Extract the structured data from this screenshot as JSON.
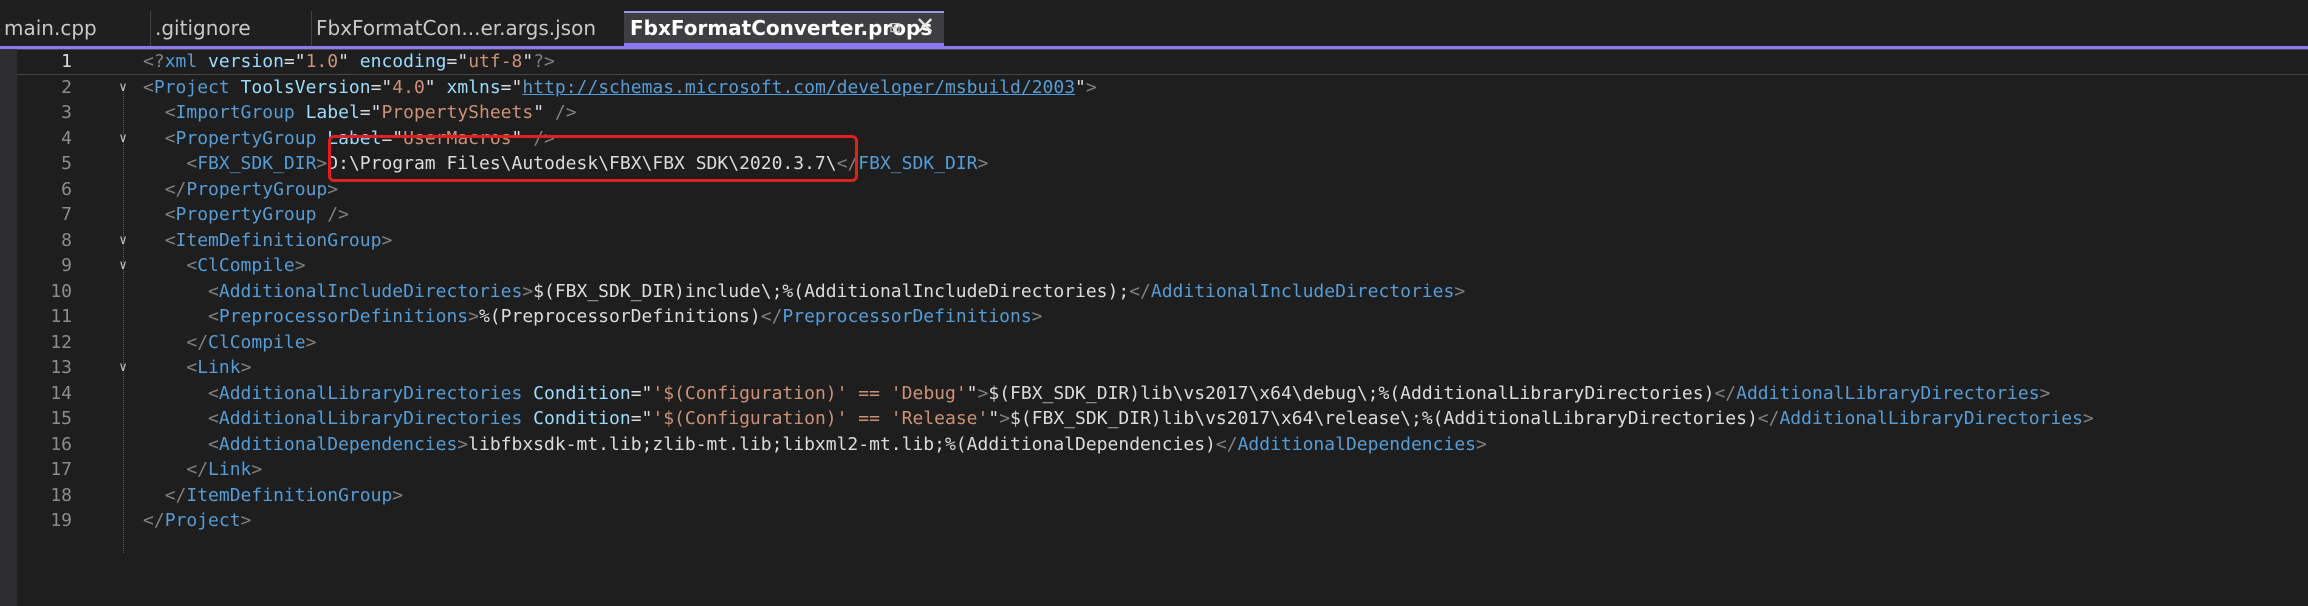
{
  "tabs": [
    {
      "label": "main.cpp",
      "active": false
    },
    {
      "label": ".gitignore",
      "active": false
    },
    {
      "label": "FbxFormatCon...er.args.json",
      "active": false
    },
    {
      "label": "FbxFormatConverter.props",
      "active": true
    }
  ],
  "tab_icons": {
    "pin": "pin-icon",
    "close": "close-icon"
  },
  "lines": [
    {
      "n": "1",
      "fold": "",
      "t": [
        [
          "b",
          "<?"
        ],
        [
          "t",
          "xml"
        ],
        [
          "x",
          " "
        ],
        [
          "a",
          "version"
        ],
        [
          "x",
          "=\""
        ],
        [
          "v",
          "1.0"
        ],
        [
          "x",
          "\" "
        ],
        [
          "a",
          "encoding"
        ],
        [
          "x",
          "=\""
        ],
        [
          "v",
          "utf-8"
        ],
        [
          "x",
          "\""
        ],
        [
          "b",
          "?>"
        ]
      ]
    },
    {
      "n": "2",
      "fold": "open",
      "t": [
        [
          "b",
          "<"
        ],
        [
          "t",
          "Project"
        ],
        [
          "x",
          " "
        ],
        [
          "a",
          "ToolsVersion"
        ],
        [
          "x",
          "=\""
        ],
        [
          "v",
          "4.0"
        ],
        [
          "x",
          "\" "
        ],
        [
          "a",
          "xmlns"
        ],
        [
          "x",
          "=\""
        ],
        [
          "u",
          "http://schemas.microsoft.com/developer/msbuild/2003"
        ],
        [
          "x",
          "\""
        ],
        [
          "b",
          ">"
        ]
      ]
    },
    {
      "n": "3",
      "fold": "",
      "t": [
        [
          "x",
          "  "
        ],
        [
          "b",
          "<"
        ],
        [
          "t",
          "ImportGroup"
        ],
        [
          "x",
          " "
        ],
        [
          "a",
          "Label"
        ],
        [
          "x",
          "=\""
        ],
        [
          "v",
          "PropertySheets"
        ],
        [
          "x",
          "\" "
        ],
        [
          "b",
          "/>"
        ]
      ]
    },
    {
      "n": "4",
      "fold": "open",
      "t": [
        [
          "x",
          "  "
        ],
        [
          "b",
          "<"
        ],
        [
          "t",
          "PropertyGroup"
        ],
        [
          "x",
          " "
        ],
        [
          "a",
          "Label"
        ],
        [
          "x",
          "=\""
        ],
        [
          "v",
          "UserMacros"
        ],
        [
          "x",
          "\" "
        ],
        [
          "b",
          "/>"
        ]
      ]
    },
    {
      "n": "5",
      "fold": "",
      "t": [
        [
          "x",
          "    "
        ],
        [
          "b",
          "<"
        ],
        [
          "t",
          "FBX_SDK_DIR"
        ],
        [
          "b",
          ">"
        ],
        [
          "x",
          "D:\\Program Files\\Autodesk\\FBX\\FBX SDK\\2020.3.7\\"
        ],
        [
          "b",
          "</"
        ],
        [
          "t",
          "FBX_SDK_DIR"
        ],
        [
          "b",
          ">"
        ]
      ]
    },
    {
      "n": "6",
      "fold": "",
      "t": [
        [
          "x",
          "  "
        ],
        [
          "b",
          "</"
        ],
        [
          "t",
          "PropertyGroup"
        ],
        [
          "b",
          ">"
        ]
      ]
    },
    {
      "n": "7",
      "fold": "",
      "t": [
        [
          "x",
          "  "
        ],
        [
          "b",
          "<"
        ],
        [
          "t",
          "PropertyGroup"
        ],
        [
          "x",
          " "
        ],
        [
          "b",
          "/>"
        ]
      ]
    },
    {
      "n": "8",
      "fold": "open",
      "t": [
        [
          "x",
          "  "
        ],
        [
          "b",
          "<"
        ],
        [
          "t",
          "ItemDefinitionGroup"
        ],
        [
          "b",
          ">"
        ]
      ]
    },
    {
      "n": "9",
      "fold": "open",
      "t": [
        [
          "x",
          "    "
        ],
        [
          "b",
          "<"
        ],
        [
          "t",
          "ClCompile"
        ],
        [
          "b",
          ">"
        ]
      ]
    },
    {
      "n": "10",
      "fold": "",
      "t": [
        [
          "x",
          "      "
        ],
        [
          "b",
          "<"
        ],
        [
          "t",
          "AdditionalIncludeDirectories"
        ],
        [
          "b",
          ">"
        ],
        [
          "x",
          "$(FBX_SDK_DIR)include\\;%(AdditionalIncludeDirectories);"
        ],
        [
          "b",
          "</"
        ],
        [
          "t",
          "AdditionalIncludeDirectories"
        ],
        [
          "b",
          ">"
        ]
      ]
    },
    {
      "n": "11",
      "fold": "",
      "t": [
        [
          "x",
          "      "
        ],
        [
          "b",
          "<"
        ],
        [
          "t",
          "PreprocessorDefinitions"
        ],
        [
          "b",
          ">"
        ],
        [
          "x",
          "%(PreprocessorDefinitions)"
        ],
        [
          "b",
          "</"
        ],
        [
          "t",
          "PreprocessorDefinitions"
        ],
        [
          "b",
          ">"
        ]
      ]
    },
    {
      "n": "12",
      "fold": "",
      "t": [
        [
          "x",
          "    "
        ],
        [
          "b",
          "</"
        ],
        [
          "t",
          "ClCompile"
        ],
        [
          "b",
          ">"
        ]
      ]
    },
    {
      "n": "13",
      "fold": "open",
      "t": [
        [
          "x",
          "    "
        ],
        [
          "b",
          "<"
        ],
        [
          "t",
          "Link"
        ],
        [
          "b",
          ">"
        ]
      ]
    },
    {
      "n": "14",
      "fold": "",
      "t": [
        [
          "x",
          "      "
        ],
        [
          "b",
          "<"
        ],
        [
          "t",
          "AdditionalLibraryDirectories"
        ],
        [
          "x",
          " "
        ],
        [
          "a",
          "Condition"
        ],
        [
          "x",
          "=\""
        ],
        [
          "v",
          "'$(Configuration)' == 'Debug'"
        ],
        [
          "x",
          "\""
        ],
        [
          "b",
          ">"
        ],
        [
          "x",
          "$(FBX_SDK_DIR)lib\\vs2017\\x64\\debug\\;%(AdditionalLibraryDirectories)"
        ],
        [
          "b",
          "</"
        ],
        [
          "t",
          "AdditionalLibraryDirectories"
        ],
        [
          "b",
          ">"
        ]
      ]
    },
    {
      "n": "15",
      "fold": "",
      "t": [
        [
          "x",
          "      "
        ],
        [
          "b",
          "<"
        ],
        [
          "t",
          "AdditionalLibraryDirectories"
        ],
        [
          "x",
          " "
        ],
        [
          "a",
          "Condition"
        ],
        [
          "x",
          "=\""
        ],
        [
          "v",
          "'$(Configuration)' == 'Release'"
        ],
        [
          "x",
          "\""
        ],
        [
          "b",
          ">"
        ],
        [
          "x",
          "$(FBX_SDK_DIR)lib\\vs2017\\x64\\release\\;%(AdditionalLibraryDirectories)"
        ],
        [
          "b",
          "</"
        ],
        [
          "t",
          "AdditionalLibraryDirectories"
        ],
        [
          "b",
          ">"
        ]
      ]
    },
    {
      "n": "16",
      "fold": "",
      "t": [
        [
          "x",
          "      "
        ],
        [
          "b",
          "<"
        ],
        [
          "t",
          "AdditionalDependencies"
        ],
        [
          "b",
          ">"
        ],
        [
          "x",
          "libfbxsdk-mt.lib;zlib-mt.lib;libxml2-mt.lib;%(AdditionalDependencies)"
        ],
        [
          "b",
          "</"
        ],
        [
          "t",
          "AdditionalDependencies"
        ],
        [
          "b",
          ">"
        ]
      ]
    },
    {
      "n": "17",
      "fold": "",
      "t": [
        [
          "x",
          "    "
        ],
        [
          "b",
          "</"
        ],
        [
          "t",
          "Link"
        ],
        [
          "b",
          ">"
        ]
      ]
    },
    {
      "n": "18",
      "fold": "",
      "t": [
        [
          "x",
          "  "
        ],
        [
          "b",
          "</"
        ],
        [
          "t",
          "ItemDefinitionGroup"
        ],
        [
          "b",
          ">"
        ]
      ]
    },
    {
      "n": "19",
      "fold": "",
      "t": [
        [
          "b",
          "</"
        ],
        [
          "t",
          "Project"
        ],
        [
          "b",
          ">"
        ]
      ]
    }
  ],
  "colors": {
    "tag": "#569cd6",
    "attribute": "#9cdcfe",
    "value": "#ce9178",
    "bracket": "#808080",
    "text": "#dcdcdc",
    "accent": "#8d78f0",
    "highlight": "#e02020"
  }
}
